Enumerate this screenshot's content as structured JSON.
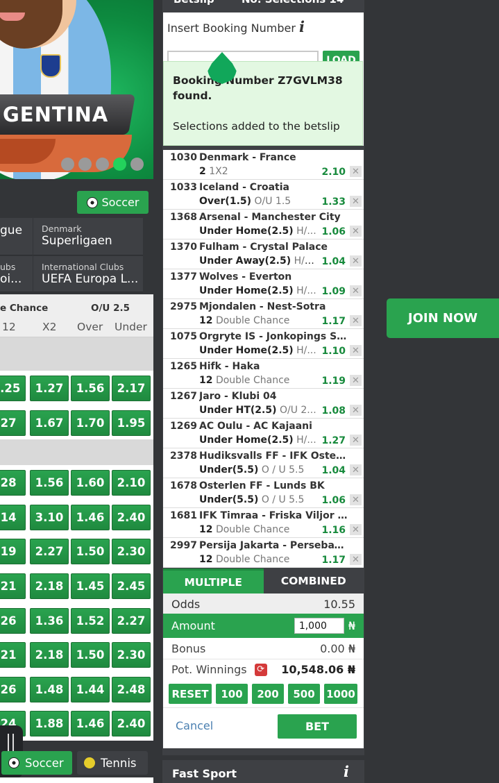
{
  "banner": {
    "team_name": "GENTINA",
    "dots_count": 5,
    "active_dot": 3
  },
  "sport_filter": {
    "label": "Soccer"
  },
  "leagues": [
    {
      "country": "",
      "name": "gue"
    },
    {
      "country": "Denmark",
      "name": "Superligaen"
    },
    {
      "country": "ubs",
      "name": "oi..."
    },
    {
      "country": "International Clubs",
      "name": "UEFA Europa L..."
    }
  ],
  "odds_table": {
    "group_headers": [
      "e Chance",
      "O/U 2.5"
    ],
    "columns": [
      "12",
      "X2",
      "Over",
      "Under"
    ],
    "sections": [
      {
        "rows": [
          [
            "1.25",
            "1.27",
            "1.56",
            "2.17"
          ],
          [
            ".27",
            "1.67",
            "1.70",
            "1.95"
          ]
        ]
      },
      {
        "rows": [
          [
            ".28",
            "1.56",
            "1.60",
            "2.10"
          ],
          [
            ".14",
            "3.10",
            "1.46",
            "2.40"
          ],
          [
            ".19",
            "2.27",
            "1.50",
            "2.30"
          ],
          [
            ".21",
            "2.18",
            "1.45",
            "2.45"
          ],
          [
            ".26",
            "1.36",
            "1.52",
            "2.27"
          ],
          [
            ".21",
            "2.18",
            "1.50",
            "2.30"
          ],
          [
            ".26",
            "1.48",
            "1.44",
            "2.48"
          ],
          [
            ".24",
            "1.88",
            "1.46",
            "2.40"
          ]
        ]
      }
    ]
  },
  "bottom_tabs": [
    {
      "label": "Soccer"
    },
    {
      "label": "Tennis"
    }
  ],
  "betslip": {
    "title": "Betslip",
    "selections_label": "No. Selections 14",
    "booking_label": "Insert Booking Number",
    "booking_input_value": "",
    "load_label": "LOAD",
    "found_line1": "Booking Number Z7GVLM38",
    "found_line2": "found.",
    "added_msg": "Selections added to the betslip",
    "selections": [
      {
        "code": "1030",
        "match": "Denmark - France",
        "pick": "2",
        "market": "1X2",
        "odd": "2.10"
      },
      {
        "code": "1033",
        "match": "Iceland - Croatia",
        "pick": "Over(1.5)",
        "market": "O/U 1.5",
        "odd": "1.33"
      },
      {
        "code": "1368",
        "match": "Arsenal - Manchester City",
        "pick": "Under Home(2.5)",
        "market": "H/...",
        "odd": "1.06"
      },
      {
        "code": "1370",
        "match": "Fulham - Crystal Palace",
        "pick": "Under Away(2.5)",
        "market": "H/A...",
        "odd": "1.04"
      },
      {
        "code": "1377",
        "match": "Wolves - Everton",
        "pick": "Under Home(2.5)",
        "market": "H/...",
        "odd": "1.09"
      },
      {
        "code": "2975",
        "match": "Mjondalen - Nest-Sotra",
        "pick": "12",
        "market": "Double Chance",
        "odd": "1.17"
      },
      {
        "code": "1075",
        "match": "Orgryte IS - Jonkopings Sod...",
        "pick": "Under Home(2.5)",
        "market": "H/...",
        "odd": "1.10"
      },
      {
        "code": "1265",
        "match": "Hifk - Haka",
        "pick": "12",
        "market": "Double Chance",
        "odd": "1.19"
      },
      {
        "code": "1267",
        "match": "Jaro - Klubi 04",
        "pick": "Under HT(2.5)",
        "market": "O/U 2...",
        "odd": "1.08"
      },
      {
        "code": "1269",
        "match": "AC Oulu - AC Kajaani",
        "pick": "Under Home(2.5)",
        "market": "H/...",
        "odd": "1.27"
      },
      {
        "code": "2378",
        "match": "Hudiksvalls FF - IFK Osters...",
        "pick": "Under(5.5)",
        "market": "O / U 5.5",
        "odd": "1.04"
      },
      {
        "code": "1678",
        "match": "Osterlen FF - Lunds BK",
        "pick": "Under(5.5)",
        "market": "O / U 5.5",
        "odd": "1.06"
      },
      {
        "code": "1681",
        "match": "IFK Timraa - Friska Viljor FC",
        "pick": "12",
        "market": "Double Chance",
        "odd": "1.16"
      },
      {
        "code": "2997",
        "match": "Persija Jakarta - Persebaya ...",
        "pick": "12",
        "market": "Double Chance",
        "odd": "1.17"
      }
    ],
    "tabs": [
      {
        "label": "MULTIPLE",
        "active": true
      },
      {
        "label": "COMBINED",
        "active": false
      }
    ],
    "odds_label": "Odds",
    "odds_value": "10.55",
    "amount_label": "Amount",
    "amount_value": "1,000",
    "currency": "₦",
    "bonus_label": "Bonus",
    "bonus_value": "0.00 ₦",
    "pot_label": "Pot. Winnings",
    "pot_value": "10,548.06 ₦",
    "quick_amounts": [
      "RESET",
      "100",
      "200",
      "500",
      "1000"
    ],
    "cancel_label": "Cancel",
    "bet_label": "BET"
  },
  "fast_sport": {
    "label": "Fast Sport"
  },
  "join_now": {
    "label": "JOIN NOW"
  },
  "colors": {
    "accent": "#2aa34f",
    "panel": "#3e4044",
    "background": "#333538"
  }
}
